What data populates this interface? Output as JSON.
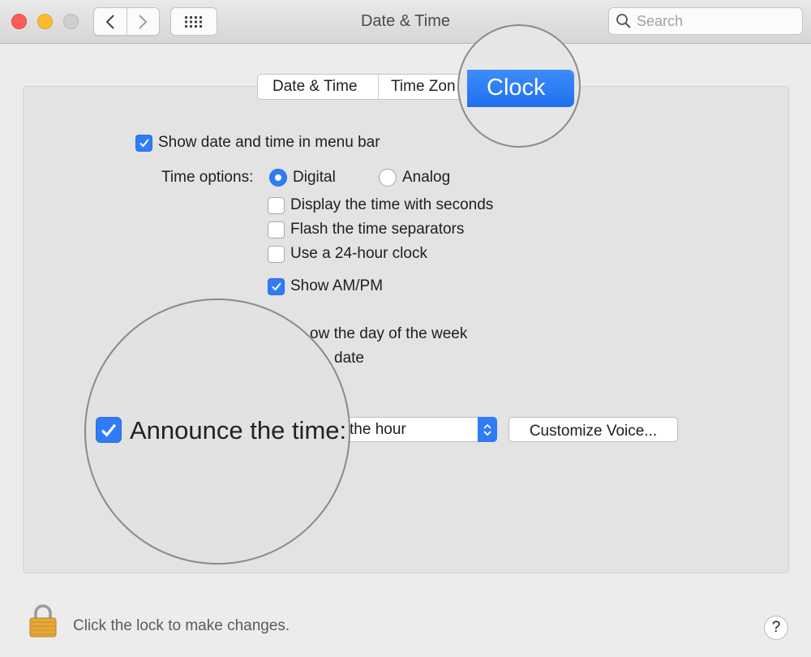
{
  "window": {
    "title": "Date & Time",
    "search_placeholder": "Search"
  },
  "tabs": [
    {
      "label": "Date & Time"
    },
    {
      "label": "Time Zon"
    },
    {
      "label": "Clock",
      "selected": true
    }
  ],
  "clock": {
    "show_in_menubar": {
      "label": "Show date and time in menu bar",
      "checked": true
    },
    "time_options_label": "Time options:",
    "digital": {
      "label": "Digital",
      "selected": true
    },
    "analog": {
      "label": "Analog",
      "selected": false
    },
    "show_seconds": {
      "label": "Display the time with seconds",
      "checked": false
    },
    "flash_separators": {
      "label": "Flash the time separators",
      "checked": false
    },
    "use_24h": {
      "label": "Use a 24-hour clock",
      "checked": false
    },
    "show_ampm": {
      "label": "Show AM/PM",
      "checked": true
    },
    "show_day": {
      "label": "ow the day of the week"
    },
    "show_date": {
      "label": "date"
    },
    "announce": {
      "label": "Announce the time:",
      "checked": true
    },
    "announce_interval": "the hour",
    "customize_voice_label": "Customize Voice..."
  },
  "footer": {
    "lock_text": "Click the lock to make changes.",
    "help_label": "?"
  },
  "colors": {
    "accent": "#2f7cf6",
    "close": "#fc5f57",
    "minimize": "#fdbc2e"
  }
}
